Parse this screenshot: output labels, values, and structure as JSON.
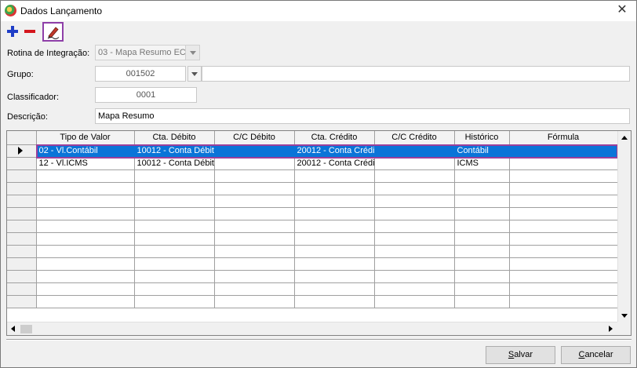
{
  "window": {
    "title": "Dados Lançamento",
    "close_glyph": "✕"
  },
  "toolbar": {
    "add_icon": "plus-icon",
    "remove_icon": "minus-icon",
    "edit_icon": "pencil-icon"
  },
  "form": {
    "rotina_label": "Rotina de Integração:",
    "rotina_value": "03 - Mapa Resumo ECF",
    "grupo_label": "Grupo:",
    "grupo_value": "001502",
    "grupo_desc_value": "",
    "classificador_label": "Classificador:",
    "classificador_value": "0001",
    "descricao_label": "Descrição:",
    "descricao_value": "Mapa Resumo"
  },
  "grid": {
    "columns": [
      "Tipo de Valor",
      "Cta. Débito",
      "C/C Débito",
      "Cta. Crédito",
      "C/C Crédito",
      "Histórico",
      "Fórmula"
    ],
    "rows": [
      [
        "02 - Vl.Contábil",
        "10012 - Conta Débit",
        "",
        "20012 - Conta Crédi",
        "",
        "Contábil",
        ""
      ],
      [
        "12 - Vl.ICMS",
        "10012 - Conta Débit",
        "",
        "20012 - Conta Crédi",
        "",
        "ICMS",
        ""
      ]
    ],
    "selected_row": 0,
    "colors": {
      "selection": "#0a74d8",
      "outline": "#9b3f9b"
    }
  },
  "buttons": {
    "save_first": "S",
    "save_rest": "alvar",
    "cancel_first": "C",
    "cancel_rest": "ancelar"
  }
}
